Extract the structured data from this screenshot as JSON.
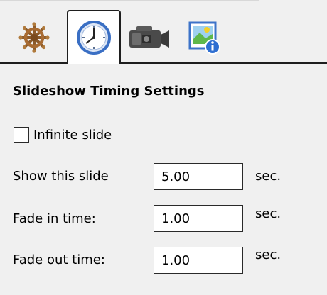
{
  "tabs": [
    {
      "id": "general",
      "icon": "ship-wheel-icon"
    },
    {
      "id": "timing",
      "icon": "clock-icon",
      "active": true
    },
    {
      "id": "video",
      "icon": "video-camera-icon"
    },
    {
      "id": "image-info",
      "icon": "image-info-icon"
    }
  ],
  "panel": {
    "title": "Slideshow Timing Settings",
    "infinite_slide": {
      "label": "Infinite slide",
      "checked": false
    },
    "show_slide": {
      "label": "Show this slide",
      "value": "5.00",
      "unit": "sec."
    },
    "fade_in": {
      "label": "Fade in time:",
      "value": "1.00",
      "unit": "sec."
    },
    "fade_out": {
      "label": "Fade out time:",
      "value": "1.00",
      "unit": "sec."
    }
  },
  "colors": {
    "background": "#f0f0f0",
    "border": "#1e1e1e",
    "clock_blue": "#3a6fc4",
    "wheel_brown": "#8b5a2b",
    "camera_dark": "#3a3a3a"
  }
}
